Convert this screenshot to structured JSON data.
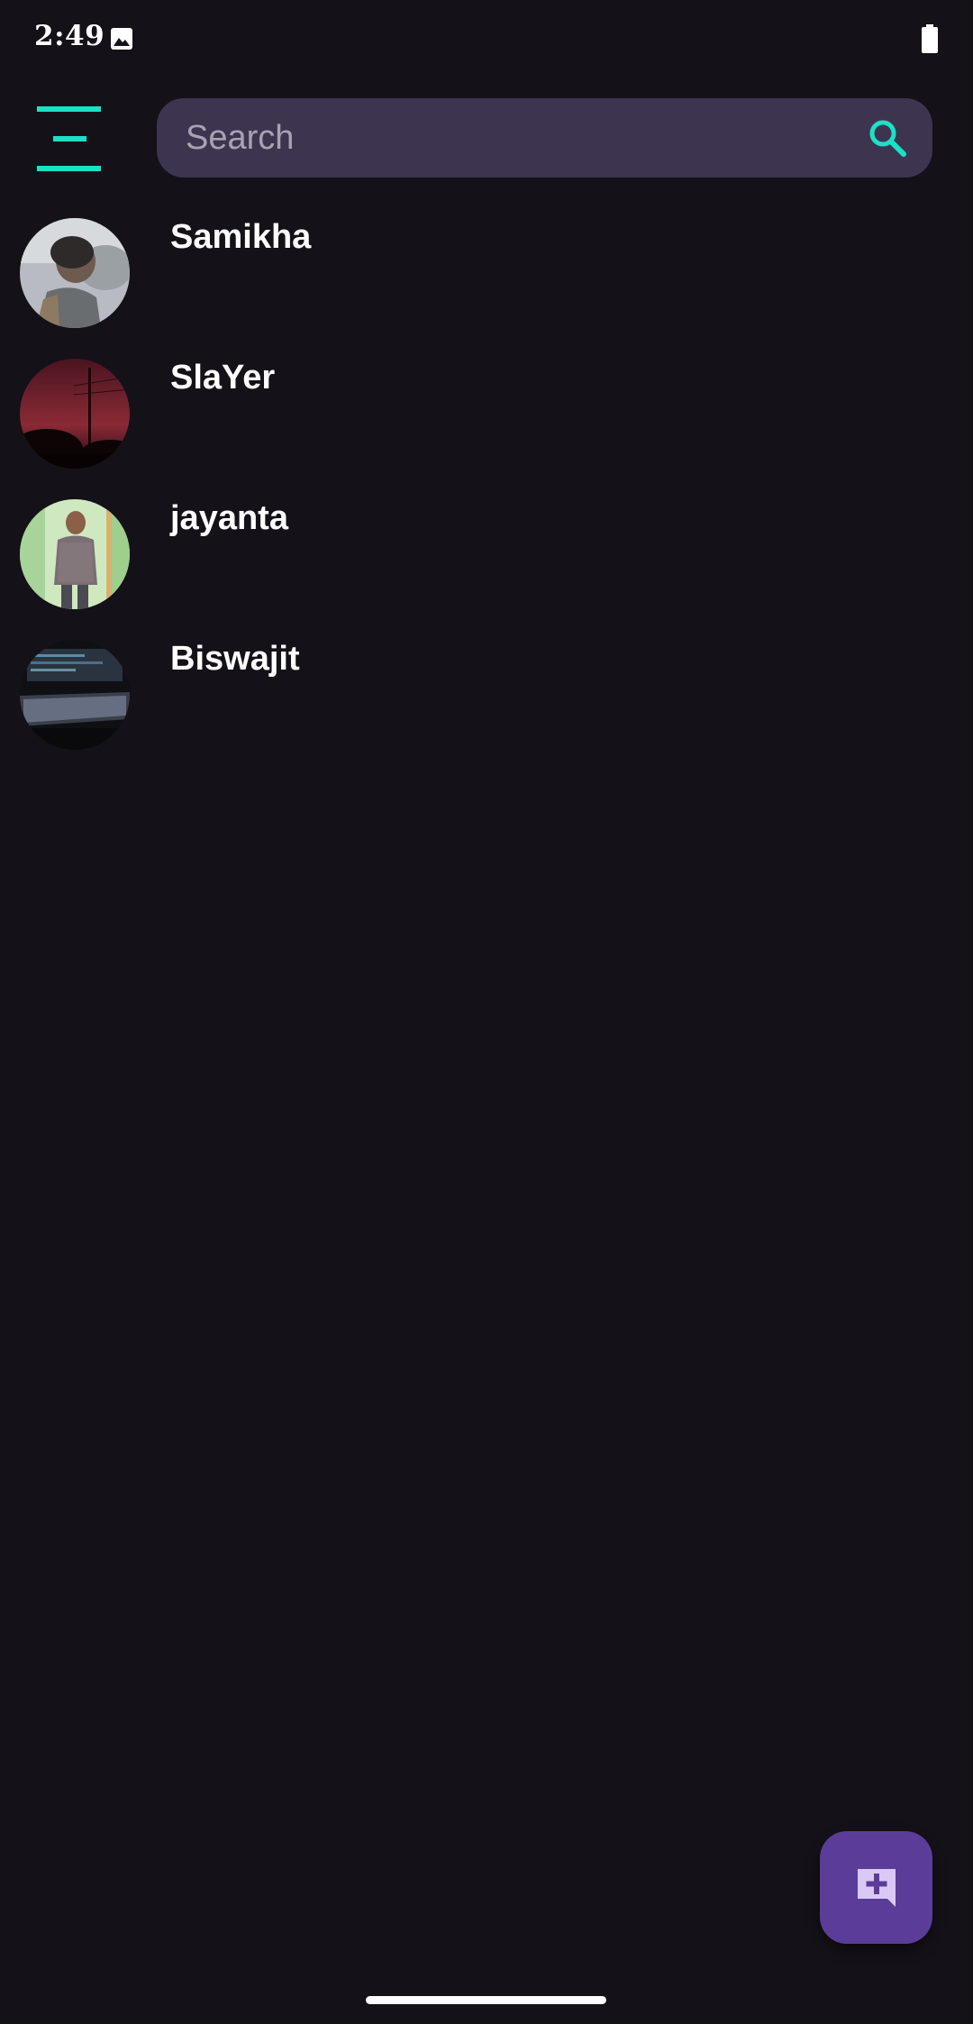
{
  "status_bar": {
    "time": "2:49",
    "icons": [
      "image-icon",
      "battery-icon"
    ]
  },
  "header": {
    "menu_icon": "menu-icon",
    "search": {
      "placeholder": "Search",
      "value": "",
      "icon": "search-icon"
    }
  },
  "contacts": [
    {
      "name": "Samikha",
      "avatar": "avatar-photo"
    },
    {
      "name": "SlaYer",
      "avatar": "avatar-photo"
    },
    {
      "name": "jayanta",
      "avatar": "avatar-photo"
    },
    {
      "name": "Biswajit",
      "avatar": "avatar-photo"
    }
  ],
  "fab": {
    "icon": "new-chat-icon"
  },
  "colors": {
    "background": "#141118",
    "accent": "#1de0c6",
    "search_bg": "#3d354f",
    "fab_bg": "#5b3d99",
    "fab_icon": "#d9c9f7"
  }
}
